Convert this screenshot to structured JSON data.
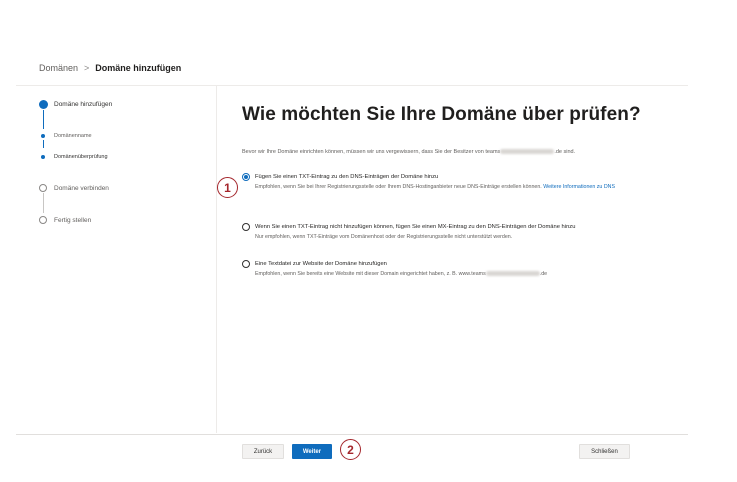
{
  "breadcrumb": {
    "root": "Domänen",
    "separator": ">",
    "current": "Domäne hinzufügen"
  },
  "stepper": {
    "steps": [
      {
        "label": "Domäne hinzufügen",
        "state": "current"
      },
      {
        "label": "Domänenname",
        "state": "done-sub"
      },
      {
        "label": "Domänenüberprüfung",
        "state": "current-sub"
      },
      {
        "label": "Domäne verbinden",
        "state": "pending"
      },
      {
        "label": "Fertig stellen",
        "state": "pending"
      }
    ]
  },
  "main": {
    "title": "Wie möchten Sie Ihre Domäne über prüfen?",
    "intro_before": "Bevor wir Ihre Domäne einrichten können, müssen wir uns vergewissern, dass Sie der Besitzer von teams",
    "intro_after": ".de sind.",
    "options": [
      {
        "label": "Fügen Sie einen TXT-Eintrag zu den DNS-Einträgen der Domäne hinzu",
        "description": "Empfohlen, wenn Sie bei Ihrer Registrierungsstelle oder Ihrem DNS-Hostinganbieter neue DNS-Einträge erstellen können.",
        "link": "Weitere Informationen zu DNS",
        "selected": true
      },
      {
        "label": "Wenn Sie einen TXT-Eintrag nicht hinzufügen können, fügen Sie einen MX-Eintrag zu den DNS-Einträgen der Domäne hinzu",
        "description": "Nur empfohlen, wenn TXT-Einträge vom Domänenhost oder der Registrierungsstelle nicht unterstützt werden.",
        "selected": false
      },
      {
        "label": "Eine Textdatei zur Website der Domäne hinzufügen",
        "description_before": "Empfohlen, wenn Sie bereits eine Website mit dieser Domain eingerichtet haben, z. B. www.teams",
        "description_after": ".de",
        "selected": false
      }
    ]
  },
  "callouts": [
    "1",
    "2"
  ],
  "footer": {
    "back_label": "Zurück",
    "next_label": "Weiter",
    "close_label": "Schließen"
  },
  "colors": {
    "accent": "#0f6cbd",
    "callout": "#a4262c"
  }
}
